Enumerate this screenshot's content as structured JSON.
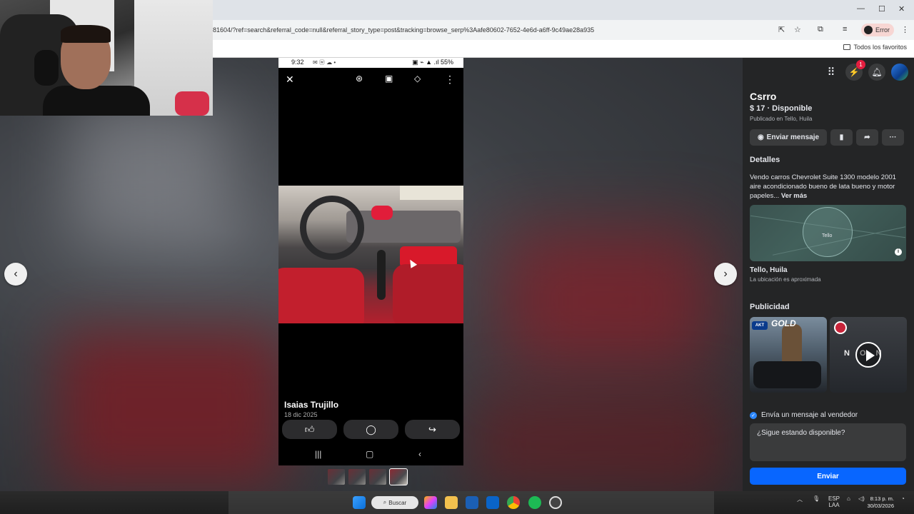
{
  "browser": {
    "url": "81604/?ref=search&referral_code=null&referral_story_type=post&tracking=browse_serp%3Aafe80602-7652-4e6d-a6ff-9c49ae28a935",
    "profile_label": "Error",
    "bookmarks_label": "Todos los favoritos"
  },
  "phone": {
    "status_time": "9:32",
    "status_right": "55%",
    "poster_name": "Isaias Trujillo",
    "post_date": "18 dic 2025"
  },
  "listing": {
    "title": "Csrro",
    "price_status": "$ 17 · Disponible",
    "published": "Publicado en Tello, Huila",
    "message_button": "Enviar mensaje",
    "details_heading": "Detalles",
    "description": "Vendo carros Chevrolet Suite 1300 modelo 2001 aire acondicionado bueno de lata bueno y motor papeles...",
    "see_more": "Ver más",
    "map_town": "Tello",
    "location_city": "Tello, Huila",
    "location_note": "La ubicación es aproximada",
    "ads_heading": "Publicidad",
    "ad1_text": "GOLD",
    "ad1_logo": "AKT",
    "ad2_text": "NON",
    "send_message_check": "Envía un mensaje al vendedor",
    "message_value": "¿Sigue estando disponible?",
    "send_button": "Enviar",
    "notification_count": "1"
  },
  "taskbar": {
    "search_label": "Buscar",
    "lang_top": "ESP",
    "lang_bottom": "LAA",
    "time": "8:13 p. m.",
    "date": "30/03/2026"
  },
  "icons": {
    "close": "close-icon",
    "next": "chevron-right-icon",
    "prev": "chevron-left-icon"
  }
}
